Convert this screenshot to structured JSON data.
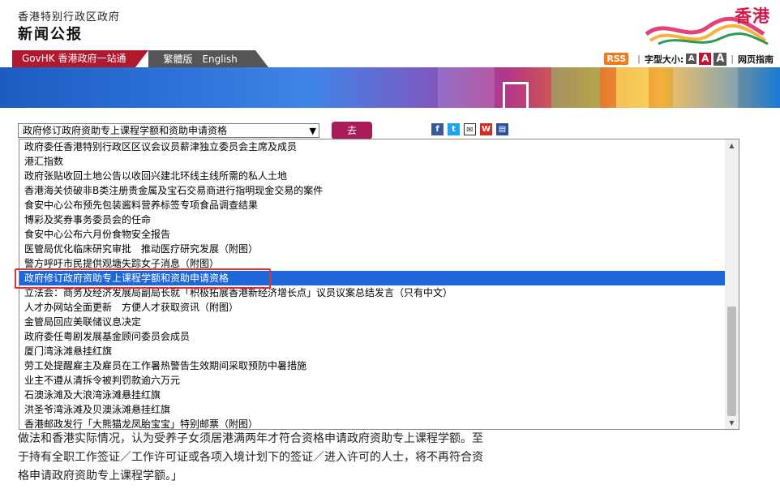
{
  "header": {
    "gov_name": "香港特别行政区政府",
    "site_title": "新闻公报",
    "logo_text": "香港"
  },
  "nav": {
    "govhk": "GovHK 香港政府一站通",
    "lang_traditional": "繁體版",
    "lang_english": "English"
  },
  "tools": {
    "rss": "RSS",
    "font_size_label": "字型大小:",
    "font_small": "A",
    "font_medium": "A",
    "font_large": "A",
    "sitemap": "网页指南"
  },
  "selector": {
    "current": "政府修订政府资助专上课程学额和资助申请资格",
    "go_label": "去"
  },
  "dropdown_items": [
    "政府委任香港特别行政区区议会议员薪津独立委员会主席及成员",
    "港汇指数",
    "政府张贴收回土地公告以收回兴建北环线主线所需的私人土地",
    "香港海关侦破非B类注册贵金属及宝石交易商进行指明现金交易的案件",
    "食安中心公布预先包装酱料营养标签专项食品调查结果",
    "博彩及奖券事务委员会的任命",
    "食安中心公布六月份食物安全报告",
    "医管局优化临床研究审批　推动医疗研究发展（附图）",
    "警方呼吁市民提供观塘失踪女子消息（附图）",
    "政府修订政府资助专上课程学额和资助申请资格",
    "立法会：商务及经济发展局副局长就「积极拓展香港新经济增长点」议员议案总结发言（只有中文）",
    "人才办网站全面更新　方便人才获取资讯（附图）",
    "金管局回应美联储议息决定",
    "政府委任粤剧发展基金顾问委员会成员",
    "厦门湾泳滩悬挂红旗",
    "劳工处提醒雇主及雇员在工作暑热警告生效期间采取预防中暑措施",
    "业主不遵从清拆令被判罚款逾六万元",
    "石澳泳滩及大浪湾泳滩悬挂红旗",
    "洪圣爷湾泳滩及贝澳泳滩悬挂红旗",
    "香港邮政发行「大熊猫龙凤胎宝宝」特别邮票（附图）"
  ],
  "selected_index": 9,
  "body_text": {
    "line1": "做法和香港实际情况，认为受养子女须居港满两年才符合资格申请政府资助专上课程学额。至",
    "line2": "于持有全职工作签证／工作许可证或各项入境计划下的签证／进入许可的人士，将不再符合资",
    "line3": "格申请政府资助专上课程学额。」"
  },
  "colors": {
    "govhk_bar": "#b0182f",
    "lang_bar": "#555555",
    "go_button": "#a81c5a",
    "selected_item": "#1e67d8",
    "highlight_border": "#e53030",
    "rss": "#f07b1a"
  },
  "icons": [
    "facebook-icon",
    "twitter-icon",
    "email-icon",
    "weibo-icon",
    "print-icon",
    "rss-icon",
    "scroll-up-icon",
    "scroll-down-icon",
    "select-arrow-icon"
  ]
}
